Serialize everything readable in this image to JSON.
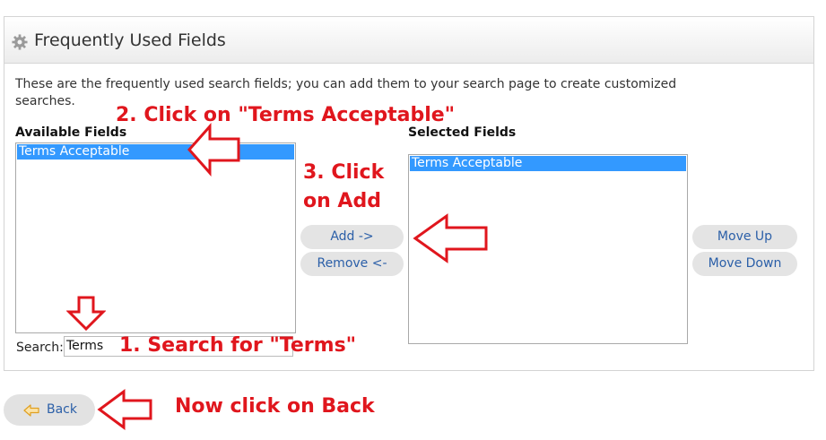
{
  "panel": {
    "title": "Frequently Used Fields",
    "icon": "gear-icon",
    "description": "These are the frequently used search fields; you can add them to your search page to create customized searches."
  },
  "available": {
    "label": "Available Fields",
    "items": [
      "Terms Acceptable"
    ]
  },
  "selected": {
    "label": "Selected Fields",
    "items": [
      "Terms Acceptable"
    ]
  },
  "buttons": {
    "add": "Add ->",
    "remove": "Remove <-",
    "move_up": "Move Up",
    "move_down": "Move Down"
  },
  "search": {
    "label": "Search:",
    "value": "Terms"
  },
  "back": {
    "label": "Back",
    "icon": "arrow-left-icon"
  },
  "annotations": {
    "step1": "1. Search for \"Terms\"",
    "step2": "2. Click on \"Terms Acceptable\"",
    "step3_line1": "3. Click",
    "step3_line2": "on Add",
    "step4": "Now click on Back",
    "color": "#e0161d"
  }
}
